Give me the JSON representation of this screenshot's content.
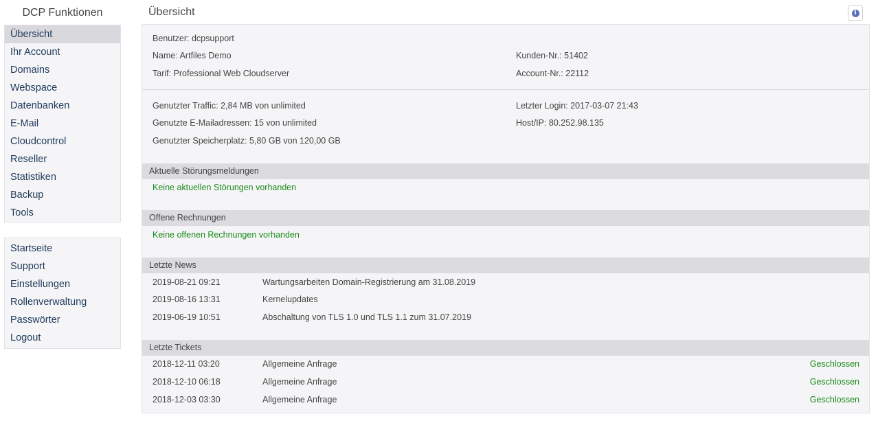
{
  "sidebar": {
    "title": "DCP Funktionen",
    "primary": [
      {
        "label": "Übersicht"
      },
      {
        "label": "Ihr Account"
      },
      {
        "label": "Domains"
      },
      {
        "label": "Webspace"
      },
      {
        "label": "Datenbanken"
      },
      {
        "label": "E-Mail"
      },
      {
        "label": "Cloudcontrol"
      },
      {
        "label": "Reseller"
      },
      {
        "label": "Statistiken"
      },
      {
        "label": "Backup"
      },
      {
        "label": "Tools"
      }
    ],
    "secondary": [
      {
        "label": "Startseite"
      },
      {
        "label": "Support"
      },
      {
        "label": "Einstellungen"
      },
      {
        "label": "Rollenverwaltung"
      },
      {
        "label": "Passwörter"
      },
      {
        "label": "Logout"
      }
    ]
  },
  "header": {
    "title": "Übersicht",
    "info_icon": "info-icon"
  },
  "account": {
    "user": "Benutzer: dcpsupport",
    "name": "Name: Artfiles Demo",
    "customer_no": "Kunden-Nr.: 51402",
    "plan": "Tarif: Professional Web Cloudserver",
    "account_no": "Account-Nr.: 22112"
  },
  "usage": {
    "traffic": "Genutzter Traffic: 2,84 MB von unlimited",
    "last_login": "Letzter Login: 2017-03-07 21:43",
    "mail_addresses": "Genutzte E-Mailadressen: 15 von unlimited",
    "host_ip": "Host/IP: 80.252.98.135",
    "storage": "Genutzter Speicherplatz: 5,80 GB von 120,00 GB"
  },
  "disruptions": {
    "header": "Aktuelle Störungsmeldungen",
    "message": "Keine aktuellen Störungen vorhanden"
  },
  "invoices": {
    "header": "Offene Rechnungen",
    "message": "Keine offenen Rechnungen vorhanden"
  },
  "news": {
    "header": "Letzte News",
    "items": [
      {
        "date": "2019-08-21 09:21",
        "title": "Wartungsarbeiten Domain-Registrierung am 31.08.2019"
      },
      {
        "date": "2019-08-16 13:31",
        "title": "Kernelupdates"
      },
      {
        "date": "2019-06-19 10:51",
        "title": "Abschaltung von TLS 1.0 und TLS 1.1 zum 31.07.2019"
      }
    ]
  },
  "tickets": {
    "header": "Letzte Tickets",
    "items": [
      {
        "date": "2018-12-11 03:20",
        "subject": "Allgemeine Anfrage",
        "status": "Geschlossen"
      },
      {
        "date": "2018-12-10 06:18",
        "subject": "Allgemeine Anfrage",
        "status": "Geschlossen"
      },
      {
        "date": "2018-12-03 03:30",
        "subject": "Allgemeine Anfrage",
        "status": "Geschlossen"
      }
    ]
  },
  "colors": {
    "status_green": "#1a8a1a",
    "nav_text": "#1f3a5a",
    "section_header_bg": "#dcdce0"
  }
}
